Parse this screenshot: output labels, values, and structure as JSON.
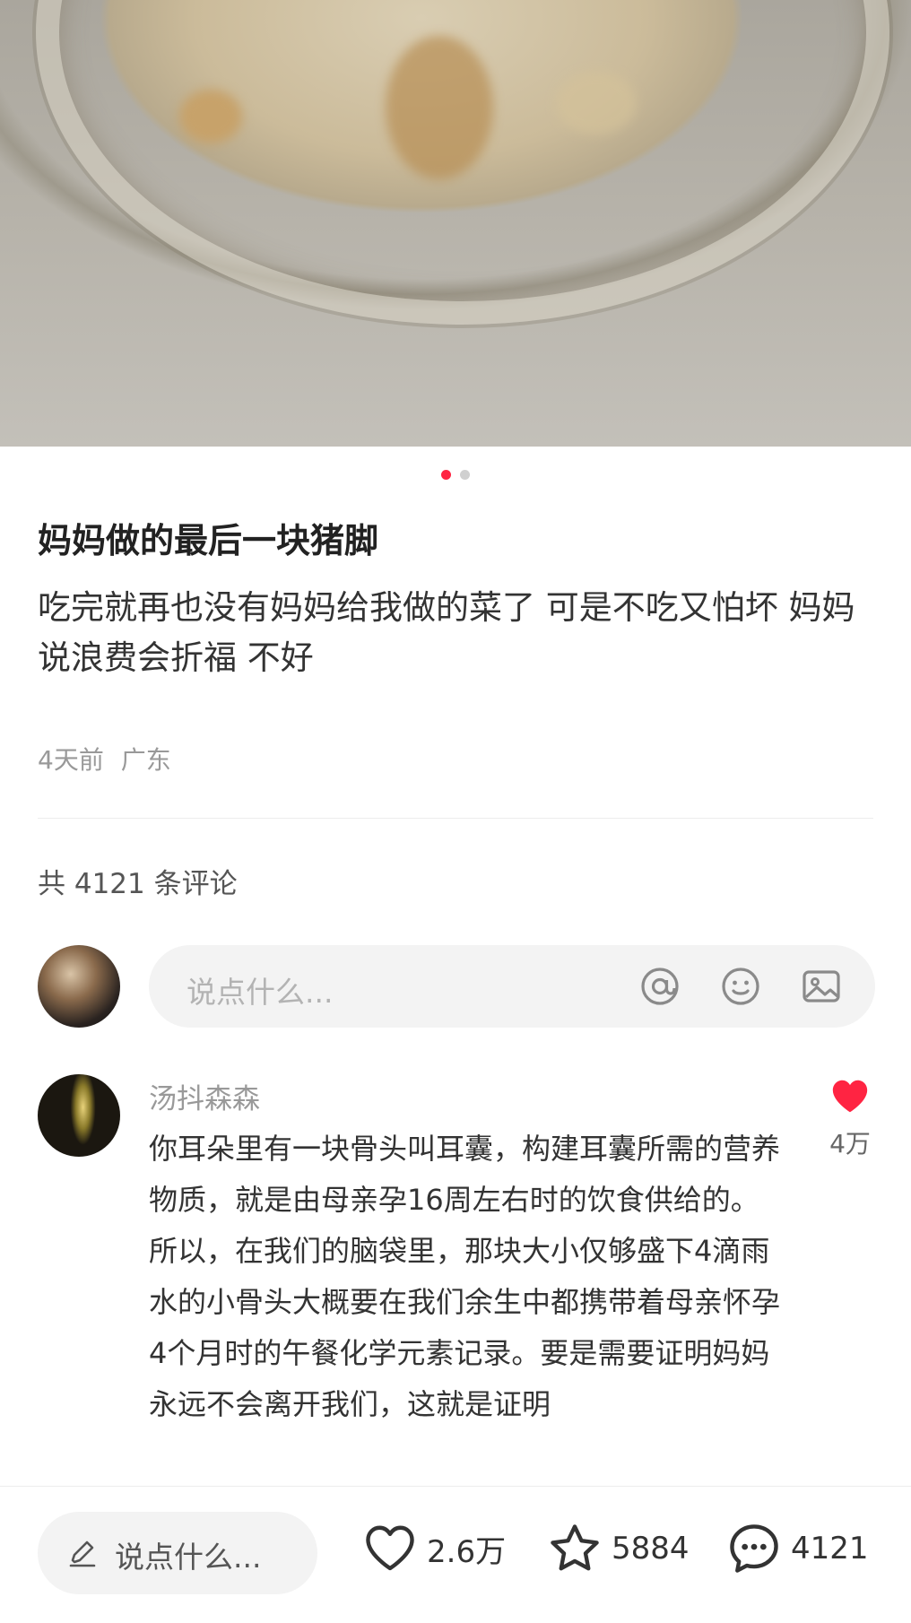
{
  "carousel": {
    "total": 2,
    "active_index": 0
  },
  "post": {
    "title": "妈妈做的最后一块猪脚",
    "body": "吃完就再也没有妈妈给我做的菜了 可是不吃又怕坏 妈妈说浪费会折福 不好",
    "time": "4天前",
    "location": "广东"
  },
  "comments_header": {
    "text": "共 4121 条评论"
  },
  "comment_input": {
    "placeholder": "说点什么...",
    "icons": [
      "at-icon",
      "emoji-icon",
      "image-icon"
    ]
  },
  "comments": [
    {
      "author": "汤抖森森",
      "text": "你耳朵里有一块骨头叫耳囊，构建耳囊所需的营养物质，就是由母亲孕16周左右时的饮食供给的。所以，在我们的脑袋里，那块大小仅够盛下4滴雨水的小骨头大概要在我们余生中都携带着母亲怀孕4个月时的午餐化学元素记录。要是需要证明妈妈永远不会离开我们，这就是证明",
      "likes": "4万",
      "liked": true
    }
  ],
  "bottom_bar": {
    "input_placeholder": "说点什么...",
    "likes": "2.6万",
    "favorites": "5884",
    "comments": "4121"
  },
  "colors": {
    "accent": "#ff2442",
    "muted": "#999999"
  }
}
